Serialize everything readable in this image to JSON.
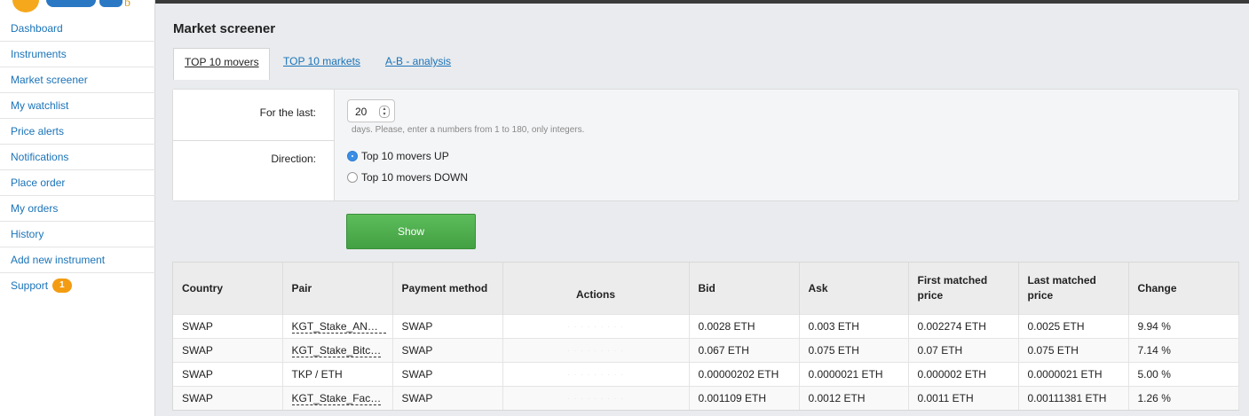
{
  "sidebar": {
    "items": [
      {
        "label": "Dashboard"
      },
      {
        "label": "Instruments"
      },
      {
        "label": "Market screener"
      },
      {
        "label": "My watchlist"
      },
      {
        "label": "Price alerts"
      },
      {
        "label": "Notifications"
      },
      {
        "label": "Place order"
      },
      {
        "label": "My orders"
      },
      {
        "label": "History"
      },
      {
        "label": "Add new instrument"
      },
      {
        "label": "Support",
        "badge": "1"
      }
    ]
  },
  "header": {
    "title": "Market screener"
  },
  "tabs": [
    {
      "label": "TOP 10 movers",
      "active": true
    },
    {
      "label": "TOP 10 markets"
    },
    {
      "label": "A-B - analysis"
    }
  ],
  "form": {
    "period_label": "For the last:",
    "period_value": "20",
    "period_hint": "days. Please, enter a numbers from 1 to 180, only integers.",
    "direction_label": "Direction:",
    "options": [
      {
        "label": "Top 10 movers UP",
        "selected": true
      },
      {
        "label": "Top 10 movers DOWN",
        "selected": false
      }
    ],
    "show_label": "Show"
  },
  "table": {
    "columns": [
      "Country",
      "Pair",
      "Payment method",
      "Actions",
      "Bid",
      "Ask",
      "First matched price",
      "Last matched price",
      "Change"
    ],
    "rows": [
      {
        "country": "SWAP",
        "pair": "KGT_Stake_ANN…",
        "payment": "SWAP",
        "bid": "0.0028 ETH",
        "ask": "0.003 ETH",
        "first": "0.002274 ETH",
        "last": "0.0025 ETH",
        "change": "9.94 %"
      },
      {
        "country": "SWAP",
        "pair": "KGT_Stake_Bitc…",
        "payment": "SWAP",
        "bid": "0.067 ETH",
        "ask": "0.075 ETH",
        "first": "0.07 ETH",
        "last": "0.075 ETH",
        "change": "7.14 %"
      },
      {
        "country": "SWAP",
        "pair": "TKP / ETH",
        "payment": "SWAP",
        "bid": "0.00000202 ETH",
        "ask": "0.0000021 ETH",
        "first": "0.000002 ETH",
        "last": "0.0000021 ETH",
        "change": "5.00 %"
      },
      {
        "country": "SWAP",
        "pair": "KGT_Stake_Fac…",
        "payment": "SWAP",
        "bid": "0.001109 ETH",
        "ask": "0.0012 ETH",
        "first": "0.0011 ETH",
        "last": "0.00111381 ETH",
        "change": "1.26 %"
      }
    ]
  }
}
